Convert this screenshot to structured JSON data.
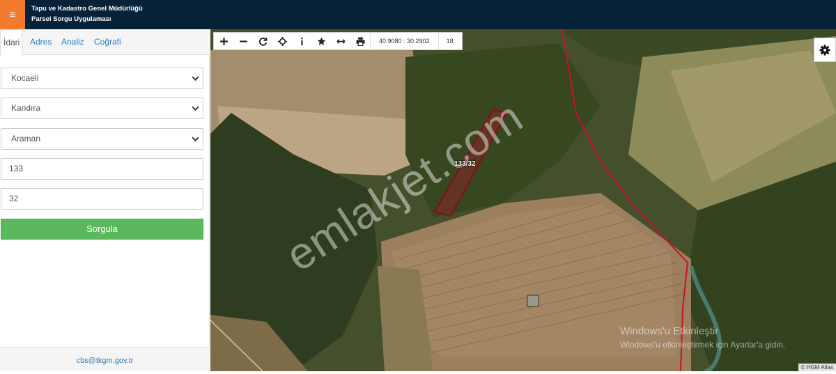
{
  "header": {
    "menu_icon": "hamburger-icon",
    "title_line1": "Tapu ve Kadastro Genel Müdürlüğü",
    "title_line2": "Parsel Sorgu Uygulaması"
  },
  "colors": {
    "header_bg": "#062239",
    "menu_bg": "#f37c2c",
    "query_button": "#5cb85c",
    "parcel_outline": "#c8102e"
  },
  "sidebar": {
    "tabs": [
      {
        "label": "İdari",
        "active": true
      },
      {
        "label": "Adres",
        "active": false
      },
      {
        "label": "Analiz",
        "active": false
      },
      {
        "label": "Coğrafi",
        "active": false
      }
    ],
    "province": "Kocaeli",
    "district": "Kandıra",
    "neighborhood": "Araman",
    "block_no": "133",
    "parcel_no": "32",
    "query_label": "Sorgula",
    "footer_email": "cbs@tkgm.gov.tr"
  },
  "map": {
    "toolbar": {
      "icons": [
        "plus-icon",
        "minus-icon",
        "refresh-icon",
        "crosshair-icon",
        "info-icon",
        "star-icon",
        "measure-icon",
        "print-icon"
      ],
      "coordinates": "40.9080 : 30.2902",
      "zoom_level": "18"
    },
    "settings_icon": "gear-icon",
    "parcel_label": "133/32",
    "watermark": "emlakjet.com",
    "windows_notice_title": "Windows'u Etkinleştir",
    "windows_notice_sub": "Windows'u etkinleştirmek için Ayarlar'a gidin.",
    "attribution": "© HGM Atlas"
  }
}
